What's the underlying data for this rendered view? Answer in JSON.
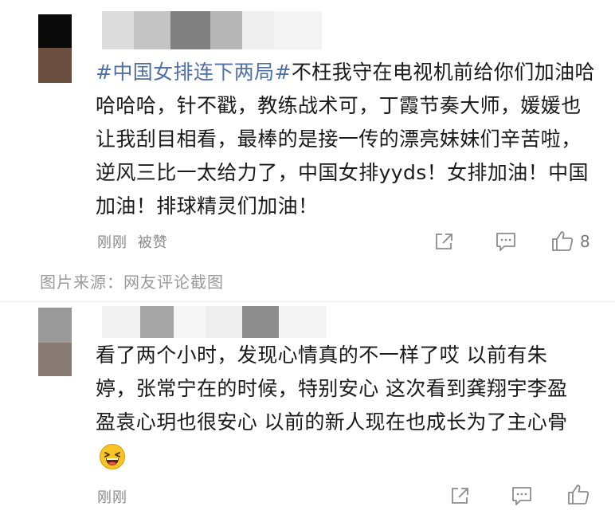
{
  "comments": [
    {
      "topic": "#中国女排连下两局#",
      "text": "不枉我守在电视机前给你们加油哈哈哈哈，针不戳，教练战术可，丁霞节奏大师，媛媛也让我刮目相看，最棒的是接一传的漂亮妹妹们辛苦啦，逆风三比一太给力了，中国女排yyds！女排加油！中国加油！排球精灵们加油！",
      "time": "刚刚",
      "tag": "被赞",
      "like_count": "8"
    },
    {
      "text": "看了两个小时，发现心情真的不一样了哎 以前有朱婷，张常宁在的时候，特别安心 这次看到龚翔宇李盈盈袁心玥也很安心 以前的新人现在也成长为了主心骨",
      "emoji": "laughing-face",
      "time": "刚刚"
    }
  ],
  "source_caption": "图片来源：网友评论截图",
  "colors": {
    "topic": "#4f6fa8",
    "meta": "#8a8a8a",
    "icon": "#8c8c8c"
  },
  "icons": [
    "share-icon",
    "comment-icon",
    "like-icon"
  ]
}
